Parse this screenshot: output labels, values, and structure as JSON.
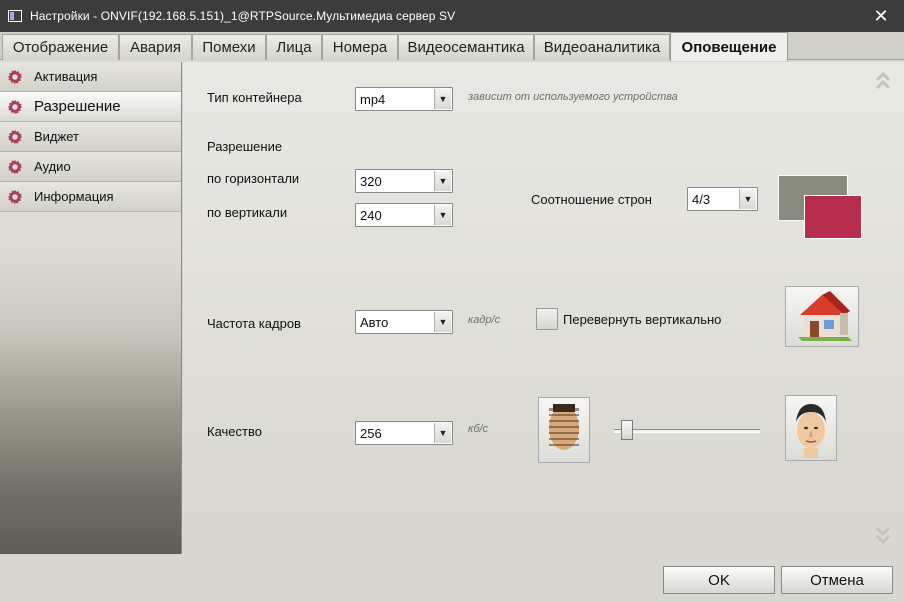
{
  "window": {
    "title": "Настройки - ONVIF(192.168.5.151)_1@RTPSource.Мультимедиа сервер SV",
    "close_glyph": "✕"
  },
  "tabs": [
    {
      "label": "Отображение",
      "active": false
    },
    {
      "label": "Авария",
      "active": false
    },
    {
      "label": "Помехи",
      "active": false
    },
    {
      "label": "Лица",
      "active": false
    },
    {
      "label": "Номера",
      "active": false
    },
    {
      "label": "Видеосемантика",
      "active": false
    },
    {
      "label": "Видеоаналитика",
      "active": false
    },
    {
      "label": "Оповещение",
      "active": true
    }
  ],
  "sidebar": {
    "items": [
      {
        "label": "Активация",
        "icon": "gear-icon",
        "active": false
      },
      {
        "label": "Разрешение",
        "icon": "gear-icon",
        "active": true
      },
      {
        "label": "Виджет",
        "icon": "gear-icon",
        "active": false
      },
      {
        "label": "Аудио",
        "icon": "gear-icon",
        "active": false
      },
      {
        "label": "Информация",
        "icon": "gear-icon",
        "active": false
      }
    ]
  },
  "form": {
    "container": {
      "label": "Тип контейнера",
      "value": "mp4",
      "hint": "зависит от используемого устройства"
    },
    "resolution": {
      "section_label": "Разрешение",
      "horizontal_label": "по горизонтали",
      "horizontal_value": "320",
      "vertical_label": "по вертикали",
      "vertical_value": "240"
    },
    "aspect": {
      "label": "Соотношение строн",
      "value": "4/3"
    },
    "framerate": {
      "label": "Частота кадров",
      "value": "Авто",
      "unit": "кадр/с"
    },
    "flip": {
      "label": "Перевернуть вертикально",
      "checked": false
    },
    "quality": {
      "label": "Качество",
      "value": "256",
      "unit": "кб/с",
      "slider_fraction": 0.05
    }
  },
  "buttons": {
    "ok": "OK",
    "cancel": "Отмена"
  },
  "colors": {
    "gear": "#b0405a",
    "aspect_back": "#8a8b80",
    "aspect_front": "#b82c4e",
    "house_roof": "#d83a2c"
  }
}
